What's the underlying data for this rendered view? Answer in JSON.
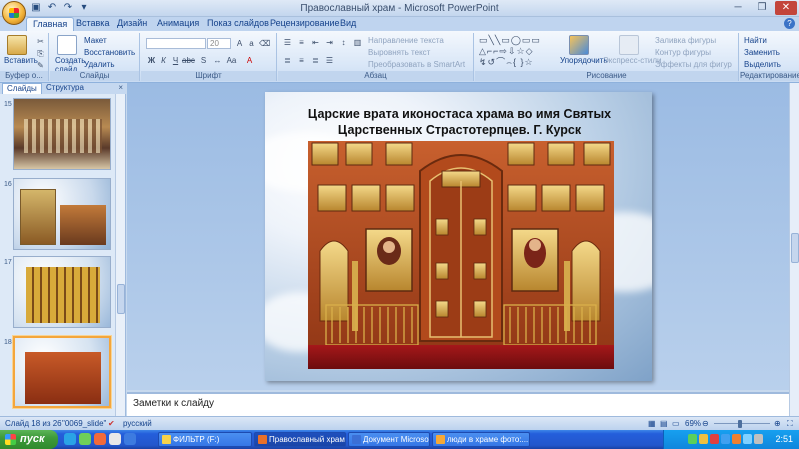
{
  "window": {
    "title": "Православный храм - Microsoft PowerPoint",
    "controls": [
      "minimize",
      "restore",
      "close"
    ]
  },
  "ribbon": {
    "tabs": [
      "Главная",
      "Вставка",
      "Дизайн",
      "Анимация",
      "Показ слайдов",
      "Рецензирование",
      "Вид"
    ],
    "active_tab": "Главная",
    "groups": {
      "clipboard": {
        "label": "Буфер о...",
        "paste": "Вставить"
      },
      "slides": {
        "label": "Слайды",
        "new_slide": "Создать слайд",
        "layout": "Макет",
        "reset": "Восстановить",
        "delete": "Удалить"
      },
      "font": {
        "label": "Шрифт",
        "font_size": "20"
      },
      "paragraph": {
        "label": "Абзац",
        "text_direction": "Направление текста",
        "align_text": "Выровнять текст",
        "smartart": "Преобразовать в SmartArt"
      },
      "drawing": {
        "label": "Рисование",
        "arrange": "Упорядочить",
        "quick_styles": "Экспресс-стили",
        "shape_fill": "Заливка фигуры",
        "shape_outline": "Контур фигуры",
        "shape_effects": "Эффекты для фигур"
      },
      "editing": {
        "label": "Редактирование",
        "find": "Найти",
        "replace": "Заменить",
        "select": "Выделить"
      }
    }
  },
  "left_panel": {
    "tabs": [
      "Слайды",
      "Структура"
    ],
    "active_tab": "Слайды",
    "close": "×",
    "thumbnails": [
      {
        "number": "15"
      },
      {
        "number": "16"
      },
      {
        "number": "17"
      },
      {
        "number": "18",
        "selected": true
      }
    ]
  },
  "slide": {
    "title_line1": "Царские врата иконостаса храма во имя Святых",
    "title_line2": "Царственных Страстотерпцев.   Г. Курск"
  },
  "notes": {
    "placeholder": "Заметки к слайду"
  },
  "status_bar": {
    "slide_info": "Слайд 18 из 26",
    "theme": "\"0069_slide\"",
    "language": "русский",
    "zoom": "69%"
  },
  "taskbar": {
    "start": "пуск",
    "tasks": [
      {
        "label": "ФИЛЬТР (F:)",
        "active": false
      },
      {
        "label": "Православный храм",
        "active": true
      },
      {
        "label": "Документ Microsoft ...",
        "active": false
      },
      {
        "label": "люди в храме фото:...",
        "active": false
      }
    ],
    "lang": "RL",
    "clock": "2:51"
  }
}
